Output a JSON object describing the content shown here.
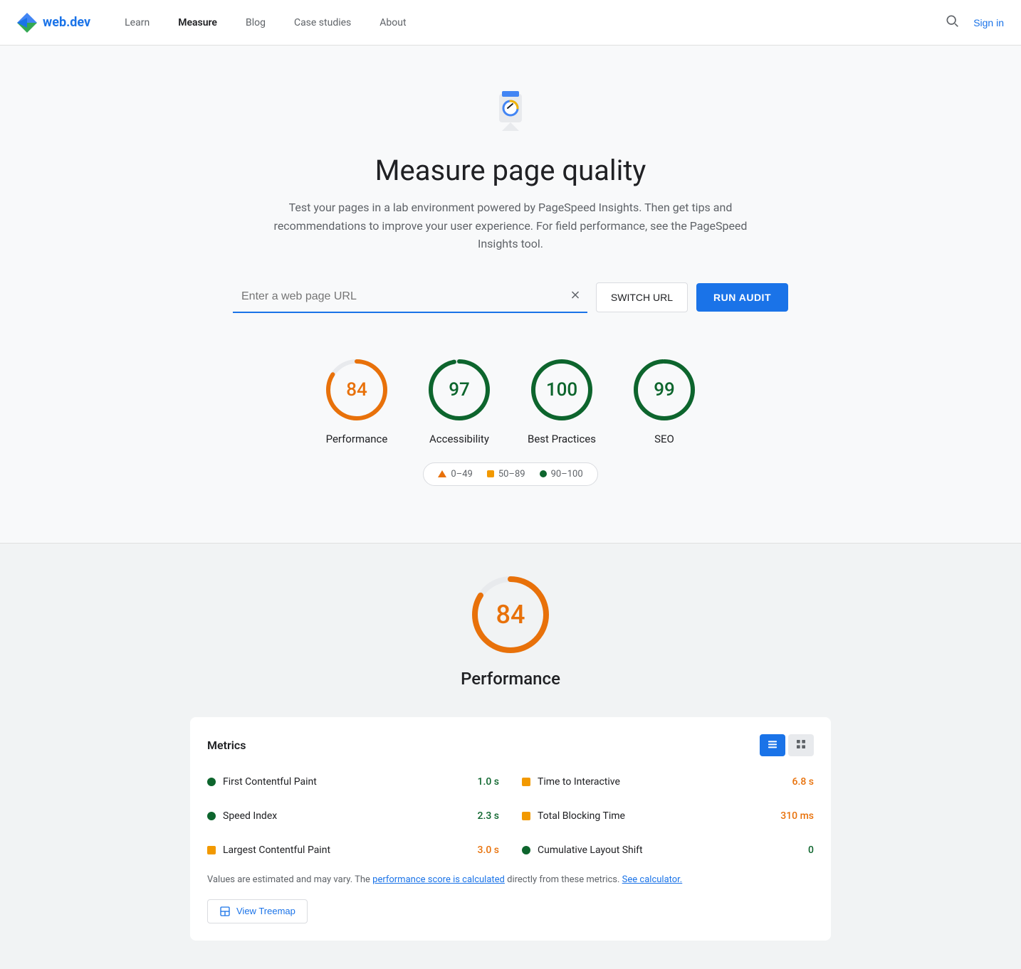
{
  "nav": {
    "logo_text": "web.dev",
    "links": [
      {
        "label": "Learn",
        "active": false
      },
      {
        "label": "Measure",
        "active": true
      },
      {
        "label": "Blog",
        "active": false
      },
      {
        "label": "Case studies",
        "active": false
      },
      {
        "label": "About",
        "active": false
      }
    ],
    "sign_in": "Sign in"
  },
  "hero": {
    "title": "Measure page quality",
    "description": "Test your pages in a lab environment powered by PageSpeed Insights. Then get tips and recommendations to improve your user experience. For field performance, see the PageSpeed Insights tool."
  },
  "url_bar": {
    "placeholder": "Enter a web page URL",
    "switch_url": "SWITCH URL",
    "run_audit": "RUN AUDIT"
  },
  "scores": [
    {
      "value": 84,
      "label": "Performance",
      "color": "#e8710a",
      "pct": 84
    },
    {
      "value": 97,
      "label": "Accessibility",
      "color": "#0d652d",
      "pct": 97
    },
    {
      "value": 100,
      "label": "Best Practices",
      "color": "#0d652d",
      "pct": 100
    },
    {
      "value": 99,
      "label": "SEO",
      "color": "#0d652d",
      "pct": 99
    }
  ],
  "legend": {
    "items": [
      {
        "type": "triangle",
        "range": "0–49"
      },
      {
        "type": "square",
        "color": "#f29900",
        "range": "50–89"
      },
      {
        "type": "dot",
        "color": "#0d652d",
        "range": "90–100"
      }
    ]
  },
  "performance_detail": {
    "score": 84,
    "label": "Performance",
    "metrics_title": "Metrics",
    "view_btn_active": "list",
    "metrics": [
      {
        "label": "First Contentful Paint",
        "value": "1.0 s",
        "dot_color": "#0d652d",
        "dot_type": "circle",
        "value_color": "green"
      },
      {
        "label": "Time to Interactive",
        "value": "6.8 s",
        "dot_color": "#f29900",
        "dot_type": "square",
        "value_color": "orange"
      },
      {
        "label": "Speed Index",
        "value": "2.3 s",
        "dot_color": "#0d652d",
        "dot_type": "circle",
        "value_color": "green"
      },
      {
        "label": "Total Blocking Time",
        "value": "310 ms",
        "dot_color": "#f29900",
        "dot_type": "square",
        "value_color": "orange"
      },
      {
        "label": "Largest Contentful Paint",
        "value": "3.0 s",
        "dot_color": "#f29900",
        "dot_type": "square",
        "value_color": "orange"
      },
      {
        "label": "Cumulative Layout Shift",
        "value": "0",
        "dot_color": "#0d652d",
        "dot_type": "circle",
        "value_color": "green"
      }
    ],
    "note_text": "Values are estimated and may vary. The ",
    "note_link1_text": "performance score is calculated",
    "note_link1_href": "#",
    "note_mid": " directly from these metrics. ",
    "note_link2_text": "See calculator.",
    "note_link2_href": "#",
    "view_treemap_label": "View Treemap"
  }
}
